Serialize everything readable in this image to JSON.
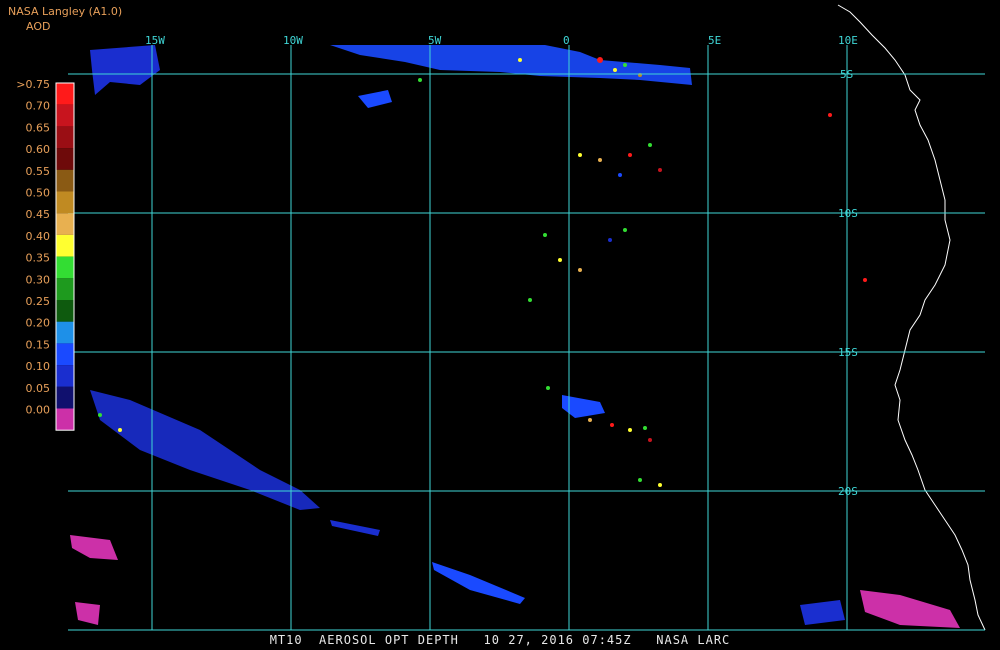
{
  "header": {
    "title": "NASA Langley (A1.0)",
    "product": "AOD"
  },
  "footer": {
    "caption": "MT10  AEROSOL OPT DEPTH   10 27, 2016 07:45Z   NASA LARC"
  },
  "grid": {
    "lon_labels": [
      "15W",
      "10W",
      "5W",
      "0",
      "5E",
      "10E"
    ],
    "lat_labels": [
      "5S",
      "10S",
      "15S",
      "20S"
    ]
  },
  "legend": {
    "labels": [
      ">0.75",
      "0.70",
      "0.65",
      "0.60",
      "0.55",
      "0.50",
      "0.45",
      "0.40",
      "0.35",
      "0.30",
      "0.25",
      "0.20",
      "0.15",
      "0.10",
      "0.05",
      "0.00"
    ],
    "colors": [
      "#ff1a1a",
      "#c8141e",
      "#9a0e14",
      "#6e0a0a",
      "#8a5a14",
      "#c08a22",
      "#e8b050",
      "#ffff30",
      "#33dd33",
      "#1e9a1e",
      "#0e5a0e",
      "#1e90e8",
      "#1a4aff",
      "#1a2ecf",
      "#10106e",
      "#cc30a8"
    ]
  },
  "colors": {
    "grid": "#3fd6d6",
    "coast": "#ffffff",
    "legend_text": "#e8a05a"
  }
}
